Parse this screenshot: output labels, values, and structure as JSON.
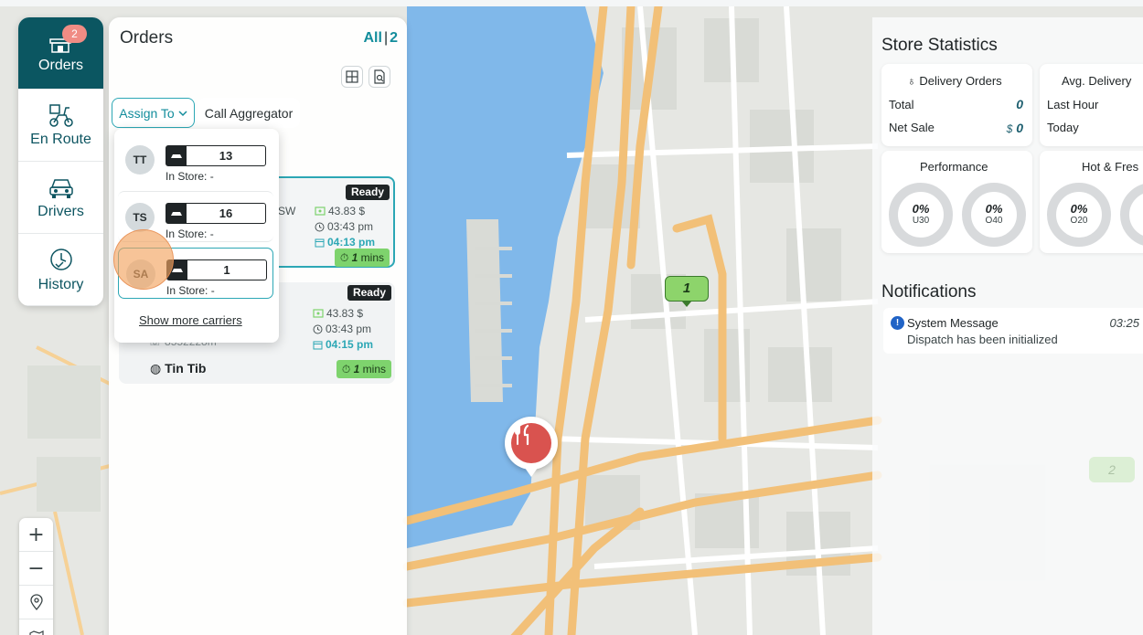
{
  "nav": {
    "orders_label": "Orders",
    "orders_badge": "2",
    "enroute_label": "En Route",
    "drivers_label": "Drivers",
    "history_label": "History"
  },
  "orders": {
    "title": "Orders",
    "all_label": "All",
    "all_count": "2",
    "assign_label": "Assign To",
    "aggregator_label": "Call Aggregator",
    "cards": [
      {
        "status": "Ready",
        "partial_text": "SW",
        "amount": "43.83 $",
        "time1": "03:43 pm",
        "time2": "04:13 pm",
        "mins_value": "1",
        "mins_unit": "mins"
      },
      {
        "status": "Ready",
        "phone_partial": "8552228m",
        "amount": "43.83 $",
        "time1": "03:43 pm",
        "time2": "04:15 pm",
        "store": "Tin Tib",
        "mins_value": "1",
        "mins_unit": "mins"
      }
    ]
  },
  "carriers": {
    "items": [
      {
        "initials": "TT",
        "count": "13",
        "instore": "In Store: -"
      },
      {
        "initials": "TS",
        "count": "16",
        "instore": "In Store: -"
      },
      {
        "initials": "SA",
        "count": "1",
        "instore": "In Store: -"
      }
    ],
    "show_more": "Show more carriers"
  },
  "stats": {
    "title": "Store Statistics",
    "delivery_orders_label": "Delivery Orders",
    "total_label": "Total",
    "total_value": "0",
    "net_sale_label": "Net Sale",
    "net_sale_currency": "$",
    "net_sale_value": "0",
    "avg_delivery_label": "Avg. Delivery",
    "last_hour_label": "Last Hour",
    "today_label": "Today",
    "performance_label": "Performance",
    "hotfresh_label": "Hot & Fres",
    "donuts": [
      {
        "pct": "0%",
        "key": "U30"
      },
      {
        "pct": "0%",
        "key": "O40"
      },
      {
        "pct": "0%",
        "key": "O20"
      }
    ]
  },
  "notifications": {
    "title": "Notifications",
    "items": [
      {
        "title": "System Message",
        "body": "Dispatch has been initialized",
        "time": "03:25"
      }
    ]
  },
  "map": {
    "driver_marker": "1",
    "faded_marker": "2",
    "colors": {
      "road": "#f2c078",
      "water": "#7fb7e8",
      "land": "#e4e6e2",
      "restaurant_pin": "#d9534f"
    }
  },
  "zoom": {
    "plus": "+",
    "minus": "−"
  }
}
